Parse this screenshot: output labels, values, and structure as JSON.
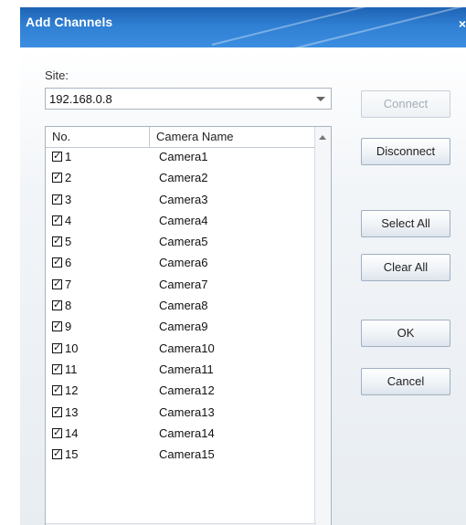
{
  "dialog": {
    "title": "Add Channels",
    "close": "×"
  },
  "site": {
    "label": "Site:",
    "value": "192.168.0.8"
  },
  "table": {
    "columns": [
      "No.",
      "Camera Name"
    ],
    "rows": [
      {
        "no": "1",
        "name": "Camera1",
        "checked": true
      },
      {
        "no": "2",
        "name": "Camera2",
        "checked": true
      },
      {
        "no": "3",
        "name": "Camera3",
        "checked": true
      },
      {
        "no": "4",
        "name": "Camera4",
        "checked": true
      },
      {
        "no": "5",
        "name": "Camera5",
        "checked": true
      },
      {
        "no": "6",
        "name": "Camera6",
        "checked": true
      },
      {
        "no": "7",
        "name": "Camera7",
        "checked": true
      },
      {
        "no": "8",
        "name": "Camera8",
        "checked": true
      },
      {
        "no": "9",
        "name": "Camera9",
        "checked": true
      },
      {
        "no": "10",
        "name": "Camera10",
        "checked": true
      },
      {
        "no": "11",
        "name": "Camera11",
        "checked": true
      },
      {
        "no": "12",
        "name": "Camera12",
        "checked": true
      },
      {
        "no": "13",
        "name": "Camera13",
        "checked": true
      },
      {
        "no": "14",
        "name": "Camera14",
        "checked": true
      },
      {
        "no": "15",
        "name": "Camera15",
        "checked": true
      }
    ]
  },
  "buttons": {
    "connect": "Connect",
    "disconnect": "Disconnect",
    "select_all": "Select All",
    "clear_all": "Clear All",
    "ok": "OK",
    "cancel": "Cancel"
  },
  "icons": {
    "checkbox": "checkmark-icon",
    "scroll_left": "chevron-left-icon",
    "scroll_right": "chevron-right-icon"
  },
  "colors": {
    "title_bar": "#2f7fd3",
    "text": "#222222",
    "disabled_text": "#a5adb6"
  }
}
